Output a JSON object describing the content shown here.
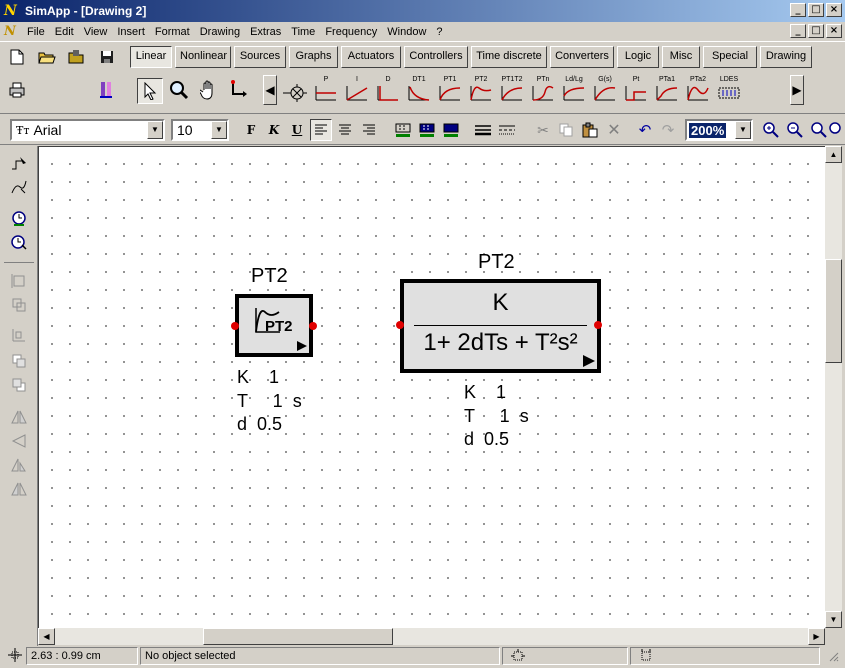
{
  "window": {
    "title": "SimApp - [Drawing 2]",
    "app_logo": "N",
    "minimize": "_",
    "maximize": "□",
    "close": "×"
  },
  "menu": [
    "File",
    "Edit",
    "View",
    "Insert",
    "Format",
    "Drawing",
    "Extras",
    "Time",
    "Frequency",
    "Window",
    "?"
  ],
  "tabs": [
    {
      "label": "Linear",
      "active": true
    },
    {
      "label": "Nonlinear"
    },
    {
      "label": "Sources"
    },
    {
      "label": "Graphs"
    },
    {
      "label": "Actuators"
    },
    {
      "label": "Controllers"
    },
    {
      "label": "Time discrete"
    },
    {
      "label": "Converters"
    },
    {
      "label": "Logic"
    },
    {
      "label": "Misc"
    },
    {
      "label": "Special"
    },
    {
      "label": "Drawing"
    }
  ],
  "blocks_palette": [
    "",
    "P",
    "I",
    "D",
    "DT1",
    "PT1",
    "PT2",
    "PT1T2",
    "PTn",
    "Ld/Lg",
    "G(s)",
    "Pt",
    "PTa1",
    "PTa2",
    "LDES"
  ],
  "format": {
    "font_name": "Arial",
    "font_size": "10",
    "bold": "F",
    "italic": "K",
    "underline": "U",
    "zoom": "200%"
  },
  "canvas": {
    "block_small": {
      "title": "PT2",
      "icon_label": "PT2",
      "params": [
        "K    1",
        "T     1  s",
        "d  0.5"
      ]
    },
    "block_large": {
      "title": "PT2",
      "numerator": "K",
      "denominator": "1+ 2dTs + T²s²",
      "params": [
        "K    1",
        "T     1  s",
        "d  0.5"
      ]
    }
  },
  "status": {
    "coords": "2.63 :  0.99 cm",
    "selection": "No object selected"
  }
}
